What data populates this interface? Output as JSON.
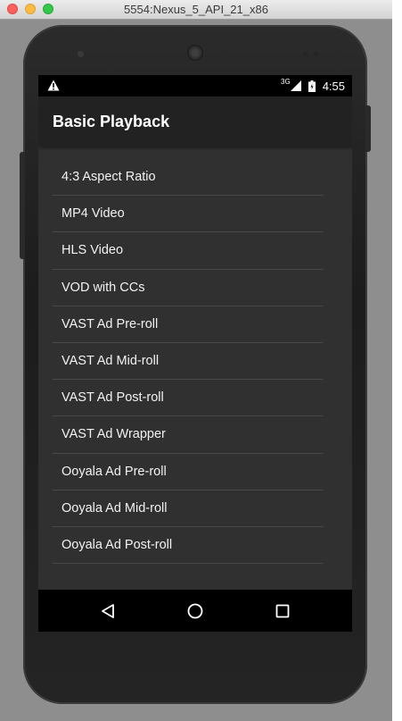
{
  "window": {
    "title": "5554:Nexus_5_API_21_x86"
  },
  "status_bar": {
    "network_type": "3G",
    "time": "4:55",
    "icons": [
      "warning-icon",
      "signal-icon",
      "battery-icon"
    ]
  },
  "app_bar": {
    "title": "Basic Playback"
  },
  "list": {
    "items": [
      {
        "label": "4:3 Aspect Ratio"
      },
      {
        "label": "MP4 Video"
      },
      {
        "label": "HLS Video"
      },
      {
        "label": "VOD with CCs"
      },
      {
        "label": "VAST Ad Pre-roll"
      },
      {
        "label": "VAST Ad Mid-roll"
      },
      {
        "label": "VAST Ad Post-roll"
      },
      {
        "label": "VAST Ad Wrapper"
      },
      {
        "label": "Ooyala Ad Pre-roll"
      },
      {
        "label": "Ooyala Ad Mid-roll"
      },
      {
        "label": "Ooyala Ad Post-roll"
      }
    ]
  },
  "nav_bar": {
    "icons": [
      "back-icon",
      "home-icon",
      "recents-icon"
    ]
  },
  "colors": {
    "screen_background": "#303030",
    "app_bar": "#222222",
    "status_bar": "#000000",
    "divider": "#4a4a4a",
    "text": "#f2f2f2"
  }
}
